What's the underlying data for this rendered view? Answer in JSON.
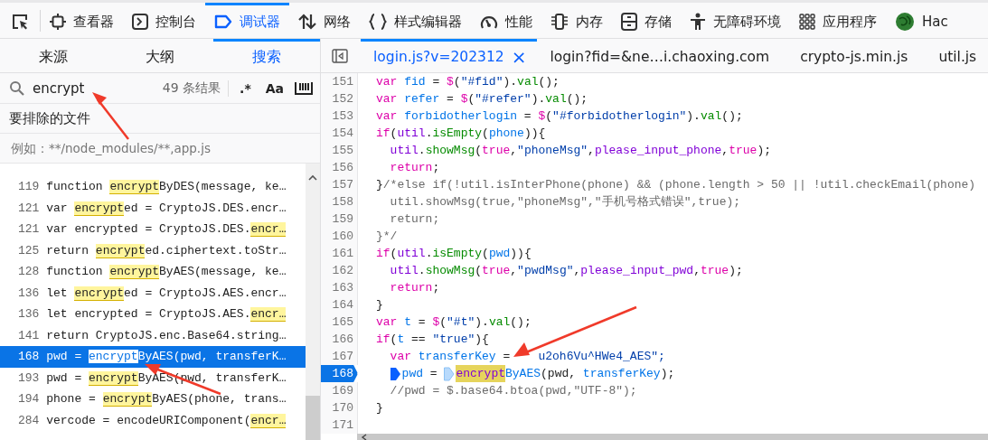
{
  "toolbar": [
    {
      "label": "查看器",
      "selected": false
    },
    {
      "label": "控制台",
      "selected": false
    },
    {
      "label": "调试器",
      "selected": true
    },
    {
      "label": "网络",
      "selected": false
    },
    {
      "label": "样式编辑器",
      "selected": false
    },
    {
      "label": "性能",
      "selected": false
    },
    {
      "label": "内存",
      "selected": false
    },
    {
      "label": "存储",
      "selected": false
    },
    {
      "label": "无障碍环境",
      "selected": false
    },
    {
      "label": "应用程序",
      "selected": false
    },
    {
      "label": "Hac",
      "selected": false
    }
  ],
  "sidebar_tabs": [
    {
      "label": "来源",
      "selected": false
    },
    {
      "label": "大纲",
      "selected": false
    },
    {
      "label": "搜索",
      "selected": true
    }
  ],
  "search": {
    "value": "encrypt",
    "count": "49 条结果",
    "regex_button": ".*",
    "case_button": "Aa"
  },
  "exclude": {
    "label": "要排除的文件",
    "placeholder": "例如：**/node_modules/**,app.js"
  },
  "results": [
    {
      "line": "119",
      "pre": "function ",
      "match": "encrypt",
      "post": "ByDES(message, ke…",
      "selected": false
    },
    {
      "line": "121",
      "pre": "var ",
      "match": "encrypt",
      "post": "ed = CryptoJS.DES.encr…",
      "selected": false
    },
    {
      "line": "121",
      "pre": "var encrypted = CryptoJS.DES.",
      "match": "encr…",
      "selected": false
    },
    {
      "line": "125",
      "pre": "return ",
      "match": "encrypt",
      "post": "ed.ciphertext.toStr…",
      "selected": false
    },
    {
      "line": "128",
      "pre": "function ",
      "match": "encrypt",
      "post": "ByAES(message, ke…",
      "selected": false
    },
    {
      "line": "136",
      "pre": "let ",
      "match": "encrypt",
      "post": "ed = CryptoJS.AES.encr…",
      "selected": false
    },
    {
      "line": "136",
      "pre": "let encrypted = CryptoJS.AES.",
      "match": "encr…",
      "selected": false
    },
    {
      "line": "141",
      "pre": "return CryptoJS.enc.Base64.string…",
      "selected": false
    },
    {
      "line": "168",
      "pre": "pwd = ",
      "match": "encrypt",
      "post": "ByAES(pwd, transferK…",
      "selected": true
    },
    {
      "line": "193",
      "pre": "pwd = ",
      "match": "encrypt",
      "post": "ByAES(pwd, transferK…",
      "selected": false
    },
    {
      "line": "194",
      "pre": "phone = ",
      "match": "encrypt",
      "post": "ByAES(phone, trans…",
      "selected": false
    },
    {
      "line": "284",
      "pre": "vercode = encodeURIComponent(",
      "match": "encr…",
      "selected": false
    }
  ],
  "editor_tabs": [
    {
      "label": "login.js?v=202312",
      "selected": true,
      "closable": true
    },
    {
      "label": "login?fid=&ne…i.chaoxing.com",
      "selected": false,
      "closable": false
    },
    {
      "label": "crypto-js.min.js",
      "selected": false,
      "closable": false
    },
    {
      "label": "util.js",
      "selected": false,
      "closable": false
    }
  ],
  "close_glyph": "×",
  "code": [
    {
      "num": "151",
      "breakpoint": false,
      "indented": false,
      "tokens": [
        {
          "kind": "kw",
          "text": "var "
        },
        {
          "kind": "id",
          "text": "fid"
        },
        {
          "kind": "p",
          "text": " = "
        },
        {
          "kind": "kw",
          "text": "$"
        },
        {
          "kind": "p",
          "text": "("
        },
        {
          "kind": "str",
          "text": "\"#fid\""
        },
        {
          "kind": "p",
          "text": ")."
        },
        {
          "kind": "fn",
          "text": "val"
        },
        {
          "kind": "p",
          "text": "();"
        }
      ]
    },
    {
      "num": "152",
      "breakpoint": false,
      "indented": false,
      "tokens": [
        {
          "kind": "kw",
          "text": "var "
        },
        {
          "kind": "id",
          "text": "refer"
        },
        {
          "kind": "p",
          "text": " = "
        },
        {
          "kind": "kw",
          "text": "$"
        },
        {
          "kind": "p",
          "text": "("
        },
        {
          "kind": "str",
          "text": "\"#refer\""
        },
        {
          "kind": "p",
          "text": ")."
        },
        {
          "kind": "fn",
          "text": "val"
        },
        {
          "kind": "p",
          "text": "();"
        }
      ]
    },
    {
      "num": "153",
      "breakpoint": false,
      "indented": false,
      "tokens": [
        {
          "kind": "kw",
          "text": "var "
        },
        {
          "kind": "id",
          "text": "forbidotherlogin"
        },
        {
          "kind": "p",
          "text": " = "
        },
        {
          "kind": "kw",
          "text": "$"
        },
        {
          "kind": "p",
          "text": "("
        },
        {
          "kind": "str",
          "text": "\"#forbidotherlogin\""
        },
        {
          "kind": "p",
          "text": ")."
        },
        {
          "kind": "fn",
          "text": "val"
        },
        {
          "kind": "p",
          "text": "();"
        }
      ]
    },
    {
      "num": "154",
      "breakpoint": false,
      "indented": false,
      "tokens": [
        {
          "kind": "kw",
          "text": "if"
        },
        {
          "kind": "p",
          "text": "("
        },
        {
          "kind": "prop",
          "text": "util"
        },
        {
          "kind": "p",
          "text": "."
        },
        {
          "kind": "fn",
          "text": "isEmpty"
        },
        {
          "kind": "p",
          "text": "("
        },
        {
          "kind": "id",
          "text": "phone"
        },
        {
          "kind": "p",
          "text": ")){"
        }
      ]
    },
    {
      "num": "155",
      "breakpoint": false,
      "indented": true,
      "tokens": [
        {
          "kind": "prop",
          "text": "util"
        },
        {
          "kind": "p",
          "text": "."
        },
        {
          "kind": "fn",
          "text": "showMsg"
        },
        {
          "kind": "p",
          "text": "("
        },
        {
          "kind": "kw",
          "text": "true"
        },
        {
          "kind": "p",
          "text": ","
        },
        {
          "kind": "str",
          "text": "\"phoneMsg\""
        },
        {
          "kind": "p",
          "text": ","
        },
        {
          "kind": "prop",
          "text": "please_input_phone"
        },
        {
          "kind": "p",
          "text": ","
        },
        {
          "kind": "kw",
          "text": "true"
        },
        {
          "kind": "p",
          "text": ");"
        }
      ]
    },
    {
      "num": "156",
      "breakpoint": false,
      "indented": true,
      "tokens": [
        {
          "kind": "kw",
          "text": "return"
        },
        {
          "kind": "p",
          "text": ";"
        }
      ]
    },
    {
      "num": "157",
      "breakpoint": false,
      "indented": false,
      "tokens": [
        {
          "kind": "p",
          "text": "}"
        },
        {
          "kind": "cm",
          "text": "/*else if(!util.isInterPhone(phone) && (phone.length > 50 || !util.checkEmail(phone)"
        }
      ]
    },
    {
      "num": "158",
      "breakpoint": false,
      "indented": true,
      "tokens": [
        {
          "kind": "cm",
          "text": "util.showMsg(true,\"phoneMsg\",\"手机号格式错误\",true);"
        }
      ]
    },
    {
      "num": "159",
      "breakpoint": false,
      "indented": true,
      "tokens": [
        {
          "kind": "cm",
          "text": "return;"
        }
      ]
    },
    {
      "num": "160",
      "breakpoint": false,
      "indented": false,
      "tokens": [
        {
          "kind": "cm",
          "text": "}*/"
        }
      ]
    },
    {
      "num": "161",
      "breakpoint": false,
      "indented": false,
      "tokens": [
        {
          "kind": "kw",
          "text": "if"
        },
        {
          "kind": "p",
          "text": "("
        },
        {
          "kind": "prop",
          "text": "util"
        },
        {
          "kind": "p",
          "text": "."
        },
        {
          "kind": "fn",
          "text": "isEmpty"
        },
        {
          "kind": "p",
          "text": "("
        },
        {
          "kind": "id",
          "text": "pwd"
        },
        {
          "kind": "p",
          "text": ")){"
        }
      ]
    },
    {
      "num": "162",
      "breakpoint": false,
      "indented": true,
      "tokens": [
        {
          "kind": "prop",
          "text": "util"
        },
        {
          "kind": "p",
          "text": "."
        },
        {
          "kind": "fn",
          "text": "showMsg"
        },
        {
          "kind": "p",
          "text": "("
        },
        {
          "kind": "kw",
          "text": "true"
        },
        {
          "kind": "p",
          "text": ","
        },
        {
          "kind": "str",
          "text": "\"pwdMsg\""
        },
        {
          "kind": "p",
          "text": ","
        },
        {
          "kind": "prop",
          "text": "please_input_pwd"
        },
        {
          "kind": "p",
          "text": ","
        },
        {
          "kind": "kw",
          "text": "true"
        },
        {
          "kind": "p",
          "text": ");"
        }
      ]
    },
    {
      "num": "163",
      "breakpoint": false,
      "indented": true,
      "tokens": [
        {
          "kind": "kw",
          "text": "return"
        },
        {
          "kind": "p",
          "text": ";"
        }
      ]
    },
    {
      "num": "164",
      "breakpoint": false,
      "indented": false,
      "tokens": [
        {
          "kind": "p",
          "text": "}"
        }
      ]
    },
    {
      "num": "165",
      "breakpoint": false,
      "indented": false,
      "tokens": [
        {
          "kind": "kw",
          "text": "var "
        },
        {
          "kind": "id",
          "text": "t"
        },
        {
          "kind": "p",
          "text": " = "
        },
        {
          "kind": "kw",
          "text": "$"
        },
        {
          "kind": "p",
          "text": "("
        },
        {
          "kind": "str",
          "text": "\"#t\""
        },
        {
          "kind": "p",
          "text": ")."
        },
        {
          "kind": "fn",
          "text": "val"
        },
        {
          "kind": "p",
          "text": "();"
        }
      ]
    },
    {
      "num": "166",
      "breakpoint": false,
      "indented": false,
      "tokens": [
        {
          "kind": "kw",
          "text": "if"
        },
        {
          "kind": "p",
          "text": "("
        },
        {
          "kind": "id",
          "text": "t"
        },
        {
          "kind": "p",
          "text": " == "
        },
        {
          "kind": "str",
          "text": "\"true\""
        },
        {
          "kind": "p",
          "text": "){"
        }
      ]
    },
    {
      "num": "167",
      "breakpoint": false,
      "indented": true,
      "tokens": [
        {
          "kind": "kw",
          "text": "var "
        },
        {
          "kind": "id",
          "text": "transferKey"
        },
        {
          "kind": "p",
          "text": " =    "
        },
        {
          "kind": "str",
          "text": "u2oh6Vu^HWe4_AES\";"
        }
      ]
    },
    {
      "num": "168",
      "breakpoint": true,
      "indented": true,
      "tokens": [
        {
          "kind": "bp"
        },
        {
          "kind": "id",
          "text": "pwd"
        },
        {
          "kind": "p",
          "text": " = "
        },
        {
          "kind": "pos"
        },
        {
          "kind": "hl",
          "text": "encrypt"
        },
        {
          "kind": "id",
          "text": "ByAES"
        },
        {
          "kind": "p",
          "text": "(pwd, "
        },
        {
          "kind": "id",
          "text": "transferKey"
        },
        {
          "kind": "p",
          "text": ");"
        }
      ]
    },
    {
      "num": "169",
      "breakpoint": false,
      "indented": true,
      "tokens": [
        {
          "kind": "cm",
          "text": "//pwd = $.base64.btoa(pwd,\"UTF-8\");"
        }
      ]
    },
    {
      "num": "170",
      "breakpoint": false,
      "indented": false,
      "tokens": [
        {
          "kind": "p",
          "text": "}"
        }
      ]
    },
    {
      "num": "171",
      "breakpoint": false
    }
  ]
}
